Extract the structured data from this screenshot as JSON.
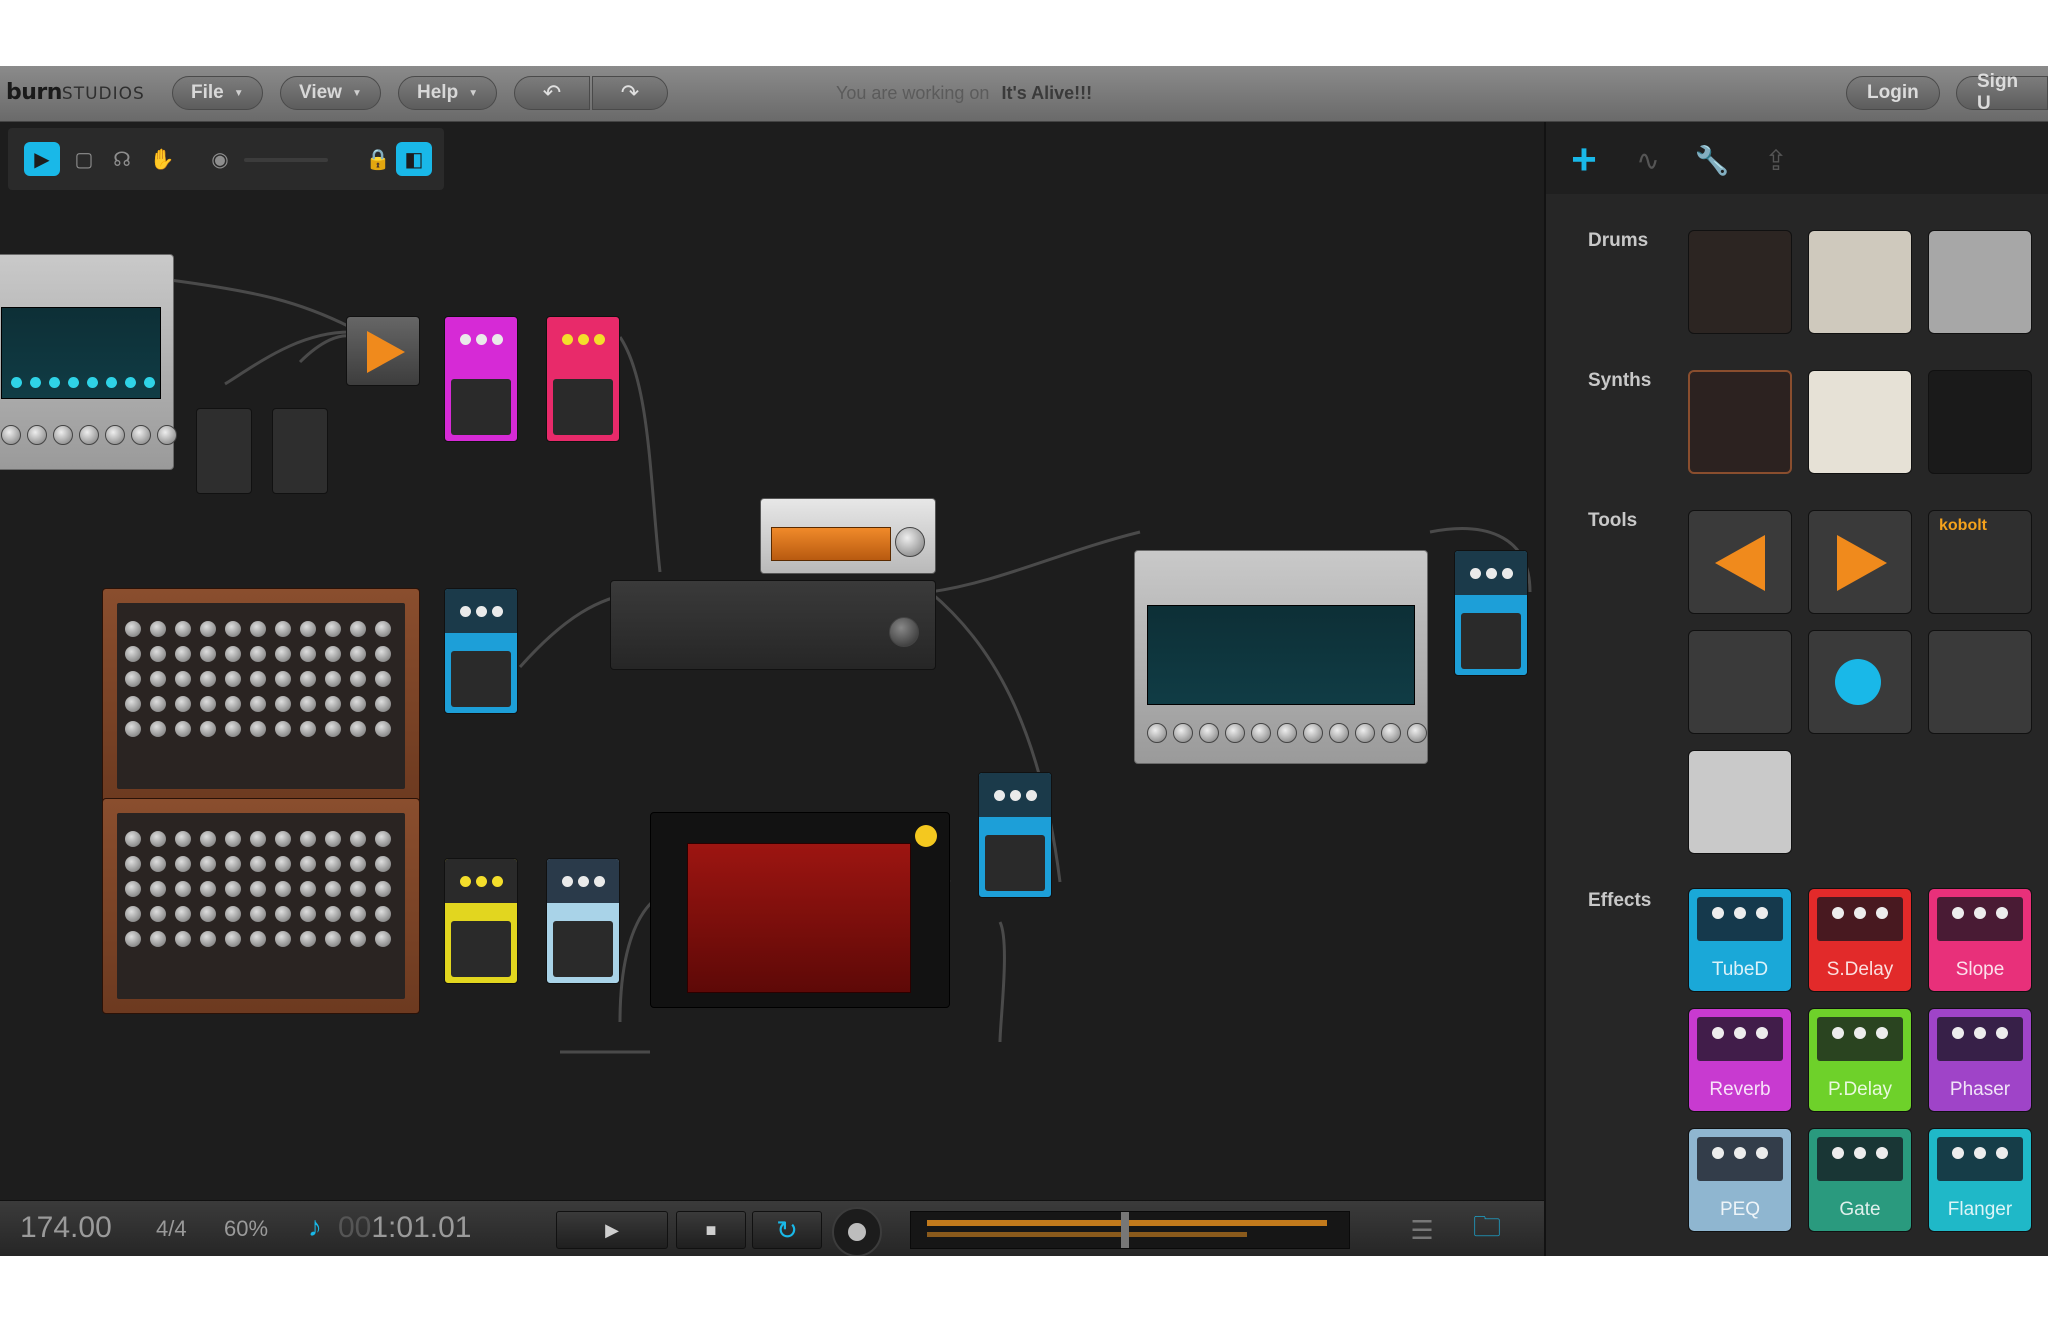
{
  "app": {
    "logo_bold": "burn",
    "logo_rest": "STUDIOS"
  },
  "menu": {
    "file": "File",
    "view": "View",
    "help": "Help"
  },
  "project": {
    "prefix": "You are working on",
    "name": "It's Alive!!!"
  },
  "auth": {
    "login": "Login",
    "signup": "Sign U"
  },
  "sidebar": {
    "tab_add_icon": "plus-icon",
    "categories": {
      "drums": "Drums",
      "synths": "Synths",
      "tools": "Tools",
      "effects": "Effects"
    },
    "tool_tile_label": "kobolt",
    "effects": [
      {
        "label": "TubeD",
        "color": "#1aa8d8"
      },
      {
        "label": "S.Delay",
        "color": "#e22a2a"
      },
      {
        "label": "Slope",
        "color": "#e8307a"
      },
      {
        "label": "Reverb",
        "color": "#c83ad0"
      },
      {
        "label": "P.Delay",
        "color": "#6ed12a"
      },
      {
        "label": "Phaser",
        "color": "#9f44c8"
      },
      {
        "label": "PEQ",
        "color": "#8fb6d0"
      },
      {
        "label": "Gate",
        "color": "#2a9a7e"
      },
      {
        "label": "Flanger",
        "color": "#1fb8c8"
      }
    ]
  },
  "transport": {
    "tempo": "174.00",
    "signature": "4/4",
    "zoom": "60%",
    "time_dim": "00",
    "time": "1:01.01",
    "loop_active_color": "#19b8e8"
  },
  "colors": {
    "accent": "#19b8e8",
    "pedal_magenta": "#d62ad6",
    "pedal_pink": "#e82a6a",
    "pedal_blue": "#1d9fd8",
    "pedal_yellow": "#e2d61f",
    "pedal_lightblue": "#a9d3e8"
  }
}
